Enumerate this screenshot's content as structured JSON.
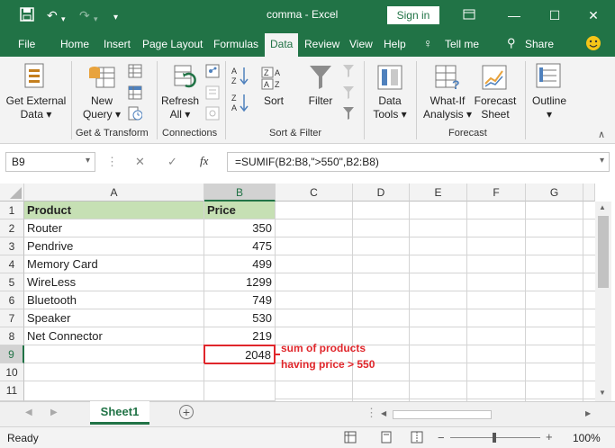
{
  "titlebar": {
    "save_icon": "save-icon",
    "title": "comma  -  Excel",
    "signin_label": "Sign in"
  },
  "tabs": [
    "File",
    "Home",
    "Insert",
    "Page Layout",
    "Formulas",
    "Data",
    "Review",
    "View",
    "Help"
  ],
  "tellme_label": "Tell me",
  "share_label": "Share",
  "ribbon": {
    "get_external_data": [
      "Get External",
      "Data ▾"
    ],
    "new_query": [
      "New",
      "Query ▾"
    ],
    "refresh_all": [
      "Refresh",
      "All ▾"
    ],
    "sort": "Sort",
    "filter": "Filter",
    "data_tools": [
      "Data",
      "Tools ▾"
    ],
    "what_if": [
      "What-If",
      "Analysis ▾"
    ],
    "forecast_sheet": [
      "Forecast",
      "Sheet"
    ],
    "outline": [
      "Outline",
      "▾"
    ],
    "groups": [
      "Get & Transform",
      "Connections",
      "Sort & Filter",
      "Forecast"
    ]
  },
  "formula_bar": {
    "name_box": "B9",
    "formula": "=SUMIF(B2:B8,\">550\",B2:B8)",
    "fx_label": "fx"
  },
  "columns": [
    "A",
    "B",
    "C",
    "D",
    "E",
    "F",
    "G"
  ],
  "rows": [
    "1",
    "2",
    "3",
    "4",
    "5",
    "6",
    "7",
    "8",
    "9",
    "10",
    "11"
  ],
  "cells": [
    [
      "Product",
      "Price"
    ],
    [
      "Router",
      "350"
    ],
    [
      "Pendrive",
      "475"
    ],
    [
      "Memory Card",
      "499"
    ],
    [
      "WireLess",
      "1299"
    ],
    [
      "Bluetooth",
      "749"
    ],
    [
      "Speaker",
      "530"
    ],
    [
      "Net Connector",
      "219"
    ],
    [
      "",
      "2048"
    ]
  ],
  "annotation": [
    "sum of products",
    "having price > 550"
  ],
  "sheet_tab": "Sheet1",
  "status": {
    "ready": "Ready",
    "zoom": "100%"
  },
  "colors": {
    "excel_green": "#217346",
    "header_fill": "#c6e0b4",
    "highlight_red": "#e0262b"
  }
}
